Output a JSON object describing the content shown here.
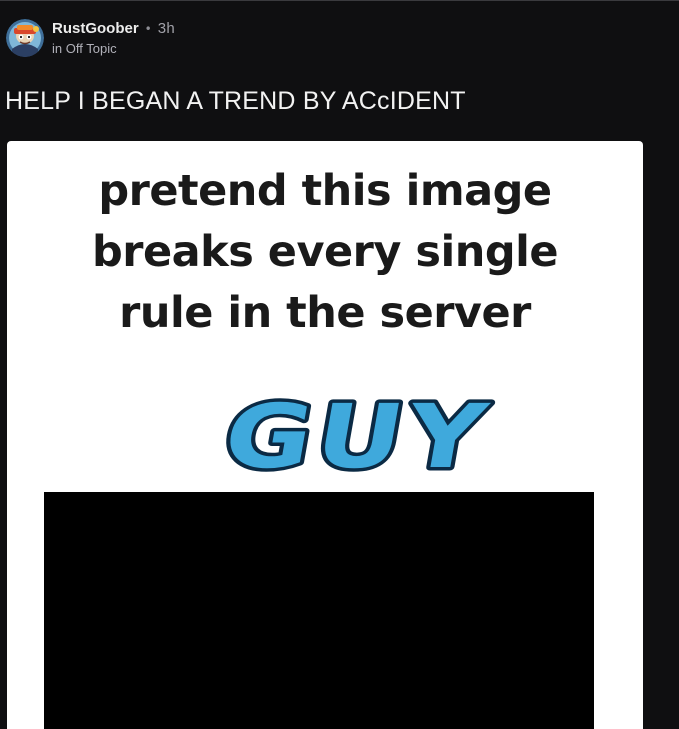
{
  "post": {
    "author": "RustGoober",
    "separator": "•",
    "timestamp": "3h",
    "community_prefix": "in",
    "community": "Off Topic",
    "title": "HELP I BEGAN A TREND BY ACcIDENT"
  },
  "media": {
    "caption_lines": [
      "pretend this image",
      "breaks every single",
      "rule in the server"
    ],
    "word_art_text": "GUY"
  },
  "colors": {
    "background": "#0f0f11",
    "word_art_fill": "#3fa9dc",
    "word_art_outline": "#0b2a44"
  },
  "icons": {
    "avatar": "avatar-image"
  }
}
